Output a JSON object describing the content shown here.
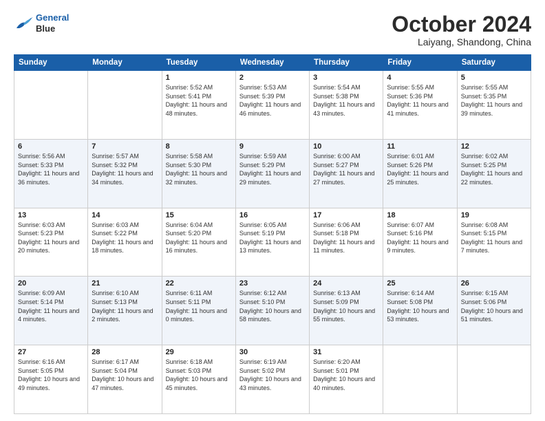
{
  "logo": {
    "line1": "General",
    "line2": "Blue"
  },
  "title": "October 2024",
  "location": "Laiyang, Shandong, China",
  "days_of_week": [
    "Sunday",
    "Monday",
    "Tuesday",
    "Wednesday",
    "Thursday",
    "Friday",
    "Saturday"
  ],
  "weeks": [
    [
      {
        "day": "",
        "sunrise": "",
        "sunset": "",
        "daylight": ""
      },
      {
        "day": "",
        "sunrise": "",
        "sunset": "",
        "daylight": ""
      },
      {
        "day": "1",
        "sunrise": "Sunrise: 5:52 AM",
        "sunset": "Sunset: 5:41 PM",
        "daylight": "Daylight: 11 hours and 48 minutes."
      },
      {
        "day": "2",
        "sunrise": "Sunrise: 5:53 AM",
        "sunset": "Sunset: 5:39 PM",
        "daylight": "Daylight: 11 hours and 46 minutes."
      },
      {
        "day": "3",
        "sunrise": "Sunrise: 5:54 AM",
        "sunset": "Sunset: 5:38 PM",
        "daylight": "Daylight: 11 hours and 43 minutes."
      },
      {
        "day": "4",
        "sunrise": "Sunrise: 5:55 AM",
        "sunset": "Sunset: 5:36 PM",
        "daylight": "Daylight: 11 hours and 41 minutes."
      },
      {
        "day": "5",
        "sunrise": "Sunrise: 5:55 AM",
        "sunset": "Sunset: 5:35 PM",
        "daylight": "Daylight: 11 hours and 39 minutes."
      }
    ],
    [
      {
        "day": "6",
        "sunrise": "Sunrise: 5:56 AM",
        "sunset": "Sunset: 5:33 PM",
        "daylight": "Daylight: 11 hours and 36 minutes."
      },
      {
        "day": "7",
        "sunrise": "Sunrise: 5:57 AM",
        "sunset": "Sunset: 5:32 PM",
        "daylight": "Daylight: 11 hours and 34 minutes."
      },
      {
        "day": "8",
        "sunrise": "Sunrise: 5:58 AM",
        "sunset": "Sunset: 5:30 PM",
        "daylight": "Daylight: 11 hours and 32 minutes."
      },
      {
        "day": "9",
        "sunrise": "Sunrise: 5:59 AM",
        "sunset": "Sunset: 5:29 PM",
        "daylight": "Daylight: 11 hours and 29 minutes."
      },
      {
        "day": "10",
        "sunrise": "Sunrise: 6:00 AM",
        "sunset": "Sunset: 5:27 PM",
        "daylight": "Daylight: 11 hours and 27 minutes."
      },
      {
        "day": "11",
        "sunrise": "Sunrise: 6:01 AM",
        "sunset": "Sunset: 5:26 PM",
        "daylight": "Daylight: 11 hours and 25 minutes."
      },
      {
        "day": "12",
        "sunrise": "Sunrise: 6:02 AM",
        "sunset": "Sunset: 5:25 PM",
        "daylight": "Daylight: 11 hours and 22 minutes."
      }
    ],
    [
      {
        "day": "13",
        "sunrise": "Sunrise: 6:03 AM",
        "sunset": "Sunset: 5:23 PM",
        "daylight": "Daylight: 11 hours and 20 minutes."
      },
      {
        "day": "14",
        "sunrise": "Sunrise: 6:03 AM",
        "sunset": "Sunset: 5:22 PM",
        "daylight": "Daylight: 11 hours and 18 minutes."
      },
      {
        "day": "15",
        "sunrise": "Sunrise: 6:04 AM",
        "sunset": "Sunset: 5:20 PM",
        "daylight": "Daylight: 11 hours and 16 minutes."
      },
      {
        "day": "16",
        "sunrise": "Sunrise: 6:05 AM",
        "sunset": "Sunset: 5:19 PM",
        "daylight": "Daylight: 11 hours and 13 minutes."
      },
      {
        "day": "17",
        "sunrise": "Sunrise: 6:06 AM",
        "sunset": "Sunset: 5:18 PM",
        "daylight": "Daylight: 11 hours and 11 minutes."
      },
      {
        "day": "18",
        "sunrise": "Sunrise: 6:07 AM",
        "sunset": "Sunset: 5:16 PM",
        "daylight": "Daylight: 11 hours and 9 minutes."
      },
      {
        "day": "19",
        "sunrise": "Sunrise: 6:08 AM",
        "sunset": "Sunset: 5:15 PM",
        "daylight": "Daylight: 11 hours and 7 minutes."
      }
    ],
    [
      {
        "day": "20",
        "sunrise": "Sunrise: 6:09 AM",
        "sunset": "Sunset: 5:14 PM",
        "daylight": "Daylight: 11 hours and 4 minutes."
      },
      {
        "day": "21",
        "sunrise": "Sunrise: 6:10 AM",
        "sunset": "Sunset: 5:13 PM",
        "daylight": "Daylight: 11 hours and 2 minutes."
      },
      {
        "day": "22",
        "sunrise": "Sunrise: 6:11 AM",
        "sunset": "Sunset: 5:11 PM",
        "daylight": "Daylight: 11 hours and 0 minutes."
      },
      {
        "day": "23",
        "sunrise": "Sunrise: 6:12 AM",
        "sunset": "Sunset: 5:10 PM",
        "daylight": "Daylight: 10 hours and 58 minutes."
      },
      {
        "day": "24",
        "sunrise": "Sunrise: 6:13 AM",
        "sunset": "Sunset: 5:09 PM",
        "daylight": "Daylight: 10 hours and 55 minutes."
      },
      {
        "day": "25",
        "sunrise": "Sunrise: 6:14 AM",
        "sunset": "Sunset: 5:08 PM",
        "daylight": "Daylight: 10 hours and 53 minutes."
      },
      {
        "day": "26",
        "sunrise": "Sunrise: 6:15 AM",
        "sunset": "Sunset: 5:06 PM",
        "daylight": "Daylight: 10 hours and 51 minutes."
      }
    ],
    [
      {
        "day": "27",
        "sunrise": "Sunrise: 6:16 AM",
        "sunset": "Sunset: 5:05 PM",
        "daylight": "Daylight: 10 hours and 49 minutes."
      },
      {
        "day": "28",
        "sunrise": "Sunrise: 6:17 AM",
        "sunset": "Sunset: 5:04 PM",
        "daylight": "Daylight: 10 hours and 47 minutes."
      },
      {
        "day": "29",
        "sunrise": "Sunrise: 6:18 AM",
        "sunset": "Sunset: 5:03 PM",
        "daylight": "Daylight: 10 hours and 45 minutes."
      },
      {
        "day": "30",
        "sunrise": "Sunrise: 6:19 AM",
        "sunset": "Sunset: 5:02 PM",
        "daylight": "Daylight: 10 hours and 43 minutes."
      },
      {
        "day": "31",
        "sunrise": "Sunrise: 6:20 AM",
        "sunset": "Sunset: 5:01 PM",
        "daylight": "Daylight: 10 hours and 40 minutes."
      },
      {
        "day": "",
        "sunrise": "",
        "sunset": "",
        "daylight": ""
      },
      {
        "day": "",
        "sunrise": "",
        "sunset": "",
        "daylight": ""
      }
    ]
  ]
}
